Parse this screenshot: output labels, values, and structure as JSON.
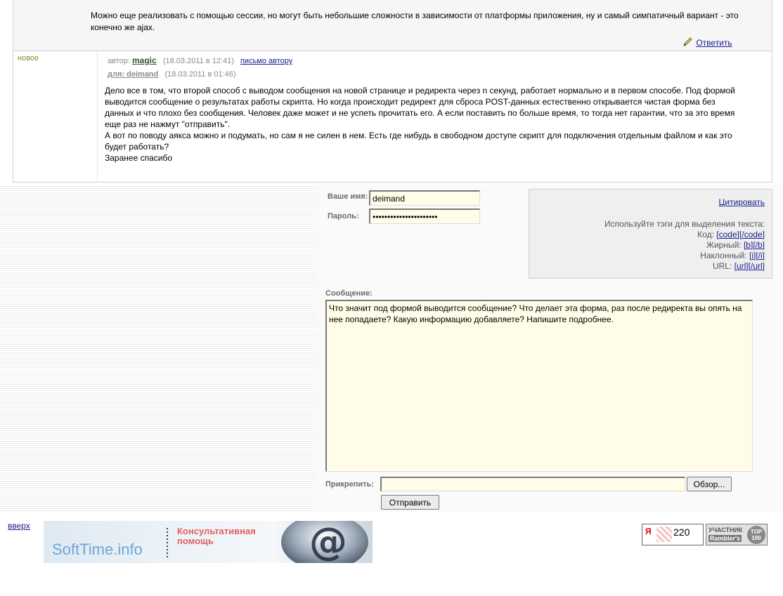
{
  "prev_post": {
    "text": "Можно еще реализовать с помощью сессии, но могут быть небольшие сложности в зависимости от платформы приложения, ну и самый симпатичный вариант - это конечно же ajax.",
    "reply_label": "Ответить"
  },
  "post": {
    "badge": "новое",
    "author_prefix": "автор:",
    "author": "magic",
    "author_time": "(18.03.2011 в 12:41)",
    "mail_label": "письмо автору",
    "to_prefix": "для: deimand",
    "to_time": "(18.03.2011 в 01:46)",
    "body": [
      "Дело все в том, что второй способ с выводом сообщения на новой странице и редиректа через n секунд, работает нормально и в первом способе. Под формой выводится сообщение о результатах работы скрипта. Но когда происходит редирект для сброса POST-данных естественно открывается чистая форма без данных и что плохо без сообщения. Человек даже может и не успеть прочитать его. А если поставить по больше время, то тогда нет гарантии, что за это время еще раз не нажмут \"отправить\".",
      "А вот по поводу аякса можно и подумать, но сам я не силен в нем. Есть где нибудь в свободном доступе скрипт для подключения отдельным файлом и как это будет работать?",
      "Заранее спасибо"
    ]
  },
  "form": {
    "name_label": "Ваше имя:",
    "name_value": "deimand",
    "password_label": "Пароль:",
    "password_value": "••••••••••••••••••••••",
    "quote_label": "Цитировать",
    "tags_hint": "Используйте тэги для выделения текста:",
    "tags": [
      {
        "label": "Код:",
        "open": "[code]",
        "close": "[/code]"
      },
      {
        "label": "Жирный:",
        "open": "[b]",
        "close": "[/b]"
      },
      {
        "label": "Наклонный:",
        "open": "[i]",
        "close": "[/i]"
      },
      {
        "label": "URL:",
        "open": "[url]",
        "close": "[/url]"
      }
    ],
    "message_label": "Сообщение:",
    "message_value": "Что значит под формой выводится сообщение? Что делает эта форма, раз после редиректа вы опять на нее попадаете? Какую информацию добавляете? Напишите подробнее.",
    "attach_label": "Прикрепить:",
    "browse_label": "Обзор...",
    "send_label": "Отправить"
  },
  "footer": {
    "up_label": "вверх",
    "banner_site": "SoftTime.info",
    "banner_line1": "Консультативная",
    "banner_line2": "помощь",
    "counter1_ya": "Я",
    "counter1_value": "220",
    "counter2_line1": "УЧАСТНИК",
    "counter2_line2": "Rambler's",
    "counter2_badge": "TOP 100"
  },
  "colors": {
    "link": "#1a1a8c",
    "field_bg": "#fffde7",
    "new_badge": "#8a8a2a"
  }
}
